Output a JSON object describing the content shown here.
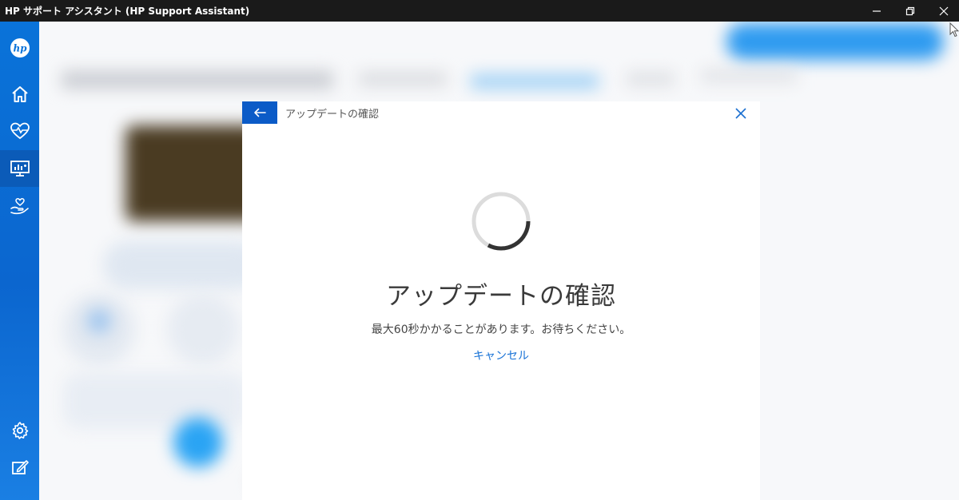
{
  "window": {
    "title": "HP サポート アシスタント (HP Support Assistant)",
    "minimize_icon": "minimize-icon",
    "maximize_icon": "restore-icon",
    "close_icon": "close-icon"
  },
  "sidebar": {
    "logo_text": "hp",
    "items": [
      {
        "icon": "home-icon"
      },
      {
        "icon": "heart-pulse-icon"
      },
      {
        "icon": "monitor-chart-icon"
      },
      {
        "icon": "hand-heart-icon"
      },
      {
        "icon": "gear-icon"
      },
      {
        "icon": "feedback-icon"
      }
    ]
  },
  "modal": {
    "header_title": "アップデートの確認",
    "back_icon": "arrow-left-icon",
    "close_icon": "close-icon",
    "main_title": "アップデートの確認",
    "subtitle": "最大60秒かかることがあります。お待ちください。",
    "cancel_label": "キャンセル"
  },
  "colors": {
    "titlebar": "#1a1a1a",
    "sidebar": "#0a73d9",
    "accent": "#0b5bc7",
    "link": "#1a73d6"
  }
}
